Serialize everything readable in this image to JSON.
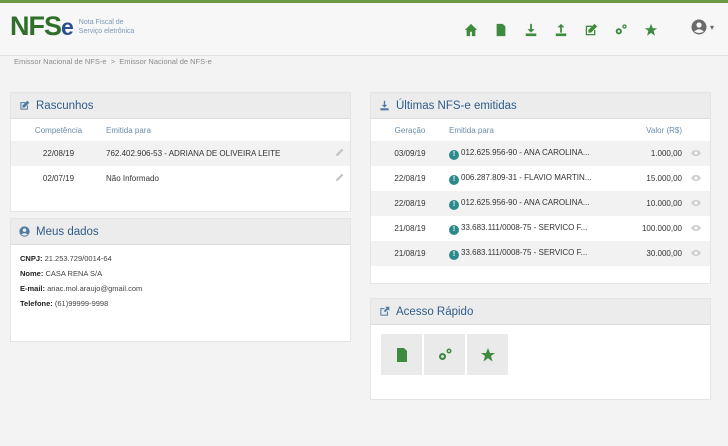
{
  "header": {
    "logo_main": "NFS",
    "logo_e": "e",
    "logo_sub": "Nota Fiscal de Serviço eletrônica",
    "nav_icons": [
      "home-icon",
      "document-icon",
      "download-icon",
      "upload-icon",
      "edit-icon",
      "settings-icon",
      "star-icon"
    ],
    "user_caret": "▾"
  },
  "breadcrumb": {
    "first": "Emissor Nacional de NFS-e",
    "separator": ">",
    "second": "Emissor Nacional de NFS-e"
  },
  "rascunhos": {
    "title": "Rascunhos",
    "col_competencia": "Competência",
    "col_emitida": "Emitida para",
    "rows": [
      {
        "competencia": "22/08/19",
        "emitida": "762.402.906-53 - ADRIANA DE OLIVEIRA LEITE"
      },
      {
        "competencia": "02/07/19",
        "emitida": "Não Informado"
      }
    ]
  },
  "meus_dados": {
    "title": "Meus dados",
    "cnpj_label": "CNPJ:",
    "cnpj": "21.253.729/0014-64",
    "nome_label": "Nome:",
    "nome": "CASA RENA S/A",
    "email_label": "E-mail:",
    "email": "anac.mol.araujo@gmail.com",
    "telefone_label": "Telefone:",
    "telefone": "(61)99999-9998"
  },
  "ultimas": {
    "title": "Últimas NFS-e emitidas",
    "col_geracao": "Geração",
    "col_emitida": "Emitida para",
    "col_valor": "Valor (R$)",
    "rows": [
      {
        "geracao": "03/09/19",
        "emitida": "012.625.956-90 - ANA CAROLINA...",
        "valor": "1.000,00"
      },
      {
        "geracao": "22/08/19",
        "emitida": "006.287.809-31 - FLAVIO MARTIN...",
        "valor": "15.000,00"
      },
      {
        "geracao": "22/08/19",
        "emitida": "012.625.956-90 - ANA CAROLINA...",
        "valor": "10.000,00"
      },
      {
        "geracao": "21/08/19",
        "emitida": "33.683.111/0008-75 - SERVICO F...",
        "valor": "100.000,00"
      },
      {
        "geracao": "21/08/19",
        "emitida": "33.683.111/0008-75 - SERVICO F...",
        "valor": "30.000,00"
      }
    ]
  },
  "acesso": {
    "title": "Acesso Rápido",
    "buttons": [
      "document-icon",
      "settings-icon",
      "star-icon"
    ]
  },
  "colors": {
    "accent_green": "#3e8a3e",
    "header_blue": "#2f5d8a",
    "info_teal": "#2c8a8a"
  }
}
